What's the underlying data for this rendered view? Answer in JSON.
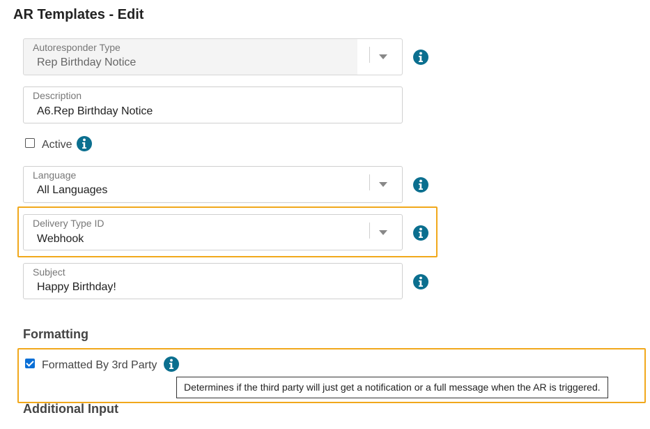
{
  "page": {
    "title": "AR Templates - Edit"
  },
  "fields": {
    "autoresponder_type": {
      "label": "Autoresponder Type",
      "value": "Rep Birthday Notice"
    },
    "description": {
      "label": "Description",
      "value": "A6.Rep Birthday Notice"
    },
    "language": {
      "label": "Language",
      "value": "All Languages"
    },
    "delivery_type": {
      "label": "Delivery Type ID",
      "value": "Webhook"
    },
    "subject": {
      "label": "Subject",
      "value": "Happy Birthday!"
    }
  },
  "active": {
    "label": "Active",
    "checked": false
  },
  "formatting": {
    "heading": "Formatting",
    "formatted_by_3rd_party": {
      "label": "Formatted By 3rd Party",
      "checked": true
    },
    "tooltip": "Determines if the third party will just get a notification or a full message when the AR is triggered."
  },
  "additional_input": {
    "heading": "Additional Input"
  },
  "colors": {
    "info_icon": "#0b6f8f",
    "highlight": "#f1a81b",
    "checkbox_accent": "#0a6fd6"
  },
  "icons": {
    "info": "info-circle-icon",
    "dropdown": "chevron-down-icon"
  }
}
